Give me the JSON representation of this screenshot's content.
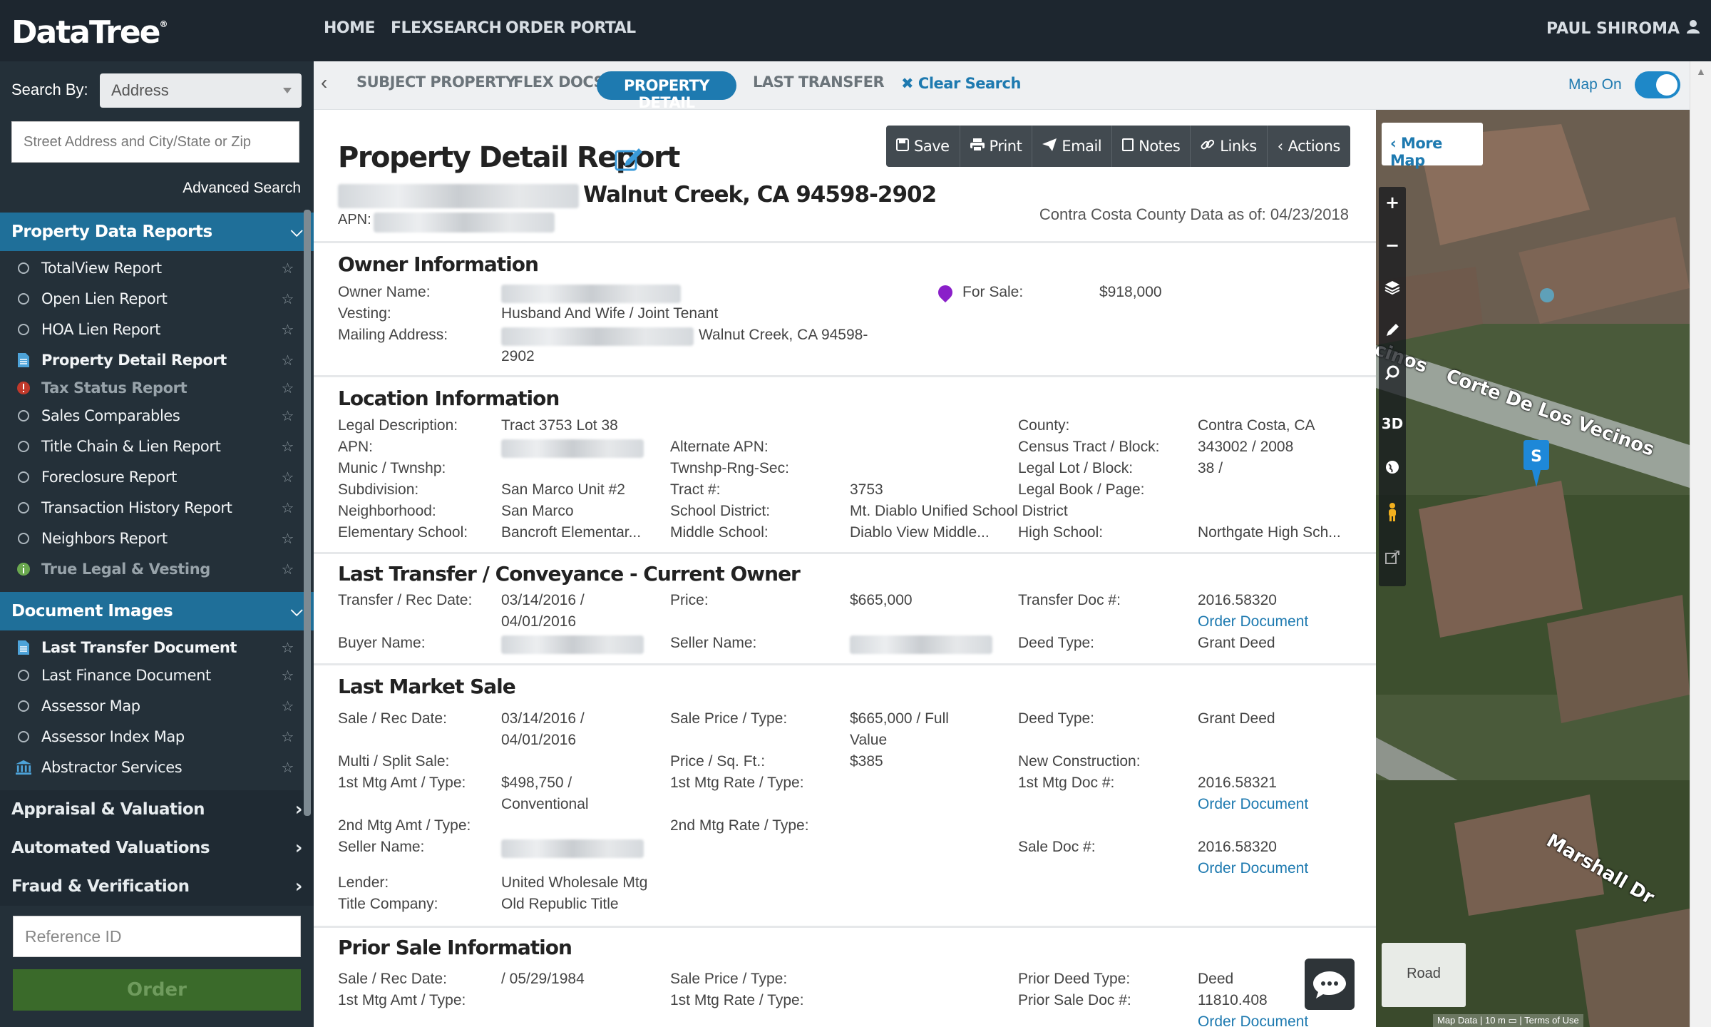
{
  "brand": {
    "logo": "DataTree"
  },
  "topnav": {
    "items": [
      "HOME",
      "FLEXSEARCH",
      "ORDER PORTAL"
    ],
    "user": "PAUL SHIROMA"
  },
  "sidebar": {
    "search_by_label": "Search By:",
    "search_by_value": "Address",
    "address_placeholder": "Street Address and City/State or Zip",
    "advanced_search": "Advanced Search",
    "property_reports_title": "Property Data Reports",
    "property_reports": [
      {
        "label": "TotalView Report",
        "icon": "circle-icon"
      },
      {
        "label": "Open Lien Report",
        "icon": "circle-icon"
      },
      {
        "label": "HOA Lien Report",
        "icon": "circle-icon"
      },
      {
        "label": "Property Detail Report",
        "icon": "document-icon",
        "active": true
      },
      {
        "label": "Tax Status Report",
        "icon": "alert-icon",
        "disabled": true
      },
      {
        "label": "Sales Comparables",
        "icon": "circle-icon"
      },
      {
        "label": "Title Chain & Lien Report",
        "icon": "circle-icon"
      },
      {
        "label": "Foreclosure Report",
        "icon": "circle-icon"
      },
      {
        "label": "Transaction History Report",
        "icon": "circle-icon"
      },
      {
        "label": "Neighbors Report",
        "icon": "circle-icon"
      },
      {
        "label": "True Legal & Vesting",
        "icon": "info-icon",
        "disabled": true
      }
    ],
    "document_images_title": "Document Images",
    "document_images": [
      {
        "label": "Last Transfer Document",
        "icon": "document-icon",
        "active": true
      },
      {
        "label": "Last Finance Document",
        "icon": "circle-icon"
      },
      {
        "label": "Assessor Map",
        "icon": "circle-icon"
      },
      {
        "label": "Assessor Index Map",
        "icon": "circle-icon"
      },
      {
        "label": "Abstractor Services",
        "icon": "bank-icon"
      }
    ],
    "collapsed_sections": [
      "Appraisal & Valuation",
      "Automated Valuations",
      "Fraud & Verification"
    ],
    "reference_placeholder": "Reference ID",
    "order_button": "Order"
  },
  "tabs": {
    "items": [
      "SUBJECT PROPERTY",
      "FLEX DOCS",
      "PROPERTY DETAIL",
      "LAST TRANSFER"
    ],
    "active": "PROPERTY DETAIL",
    "clear_search": "Clear Search",
    "map_toggle_label": "Map On"
  },
  "report": {
    "title": "Property Detail Report",
    "address_city": "Walnut Creek, CA 94598-2902",
    "apn_label": "APN:",
    "as_of": "Contra Costa County Data as of: 04/23/2018",
    "toolbar": [
      "Save",
      "Print",
      "Email",
      "Notes",
      "Links",
      "Actions"
    ],
    "owner": {
      "title": "Owner Information",
      "owner_name_label": "Owner Name:",
      "vesting_label": "Vesting:",
      "vesting": "Husband And Wife / Joint Tenant",
      "mailing_label": "Mailing Address:",
      "mailing_city": "Walnut Creek, CA 94598-",
      "mailing_zip4": "2902",
      "for_sale_label": "For Sale:",
      "for_sale_price": "$918,000"
    },
    "location": {
      "title": "Location Information",
      "legal_desc_label": "Legal Description:",
      "legal_desc": "Tract 3753 Lot 38",
      "apn_label": "APN:",
      "munic_label": "Munic / Twnshp:",
      "subdivision_label": "Subdivision:",
      "subdivision": "San Marco Unit #2",
      "neighborhood_label": "Neighborhood:",
      "neighborhood": "San Marco",
      "elem_label": "Elementary School:",
      "elem": "Bancroft Elementar...",
      "alt_apn_label": "Alternate APN:",
      "trs_label": "Twnshp-Rng-Sec:",
      "tract_label": "Tract #:",
      "tract": "3753",
      "district_label": "School District:",
      "district": "Mt. Diablo Unified School District",
      "middle_label": "Middle School:",
      "middle": "Diablo View Middle...",
      "county_label": "County:",
      "county": "Contra Costa, CA",
      "census_label": "Census Tract / Block:",
      "census": "343002 / 2008",
      "lot_label": "Legal Lot / Block:",
      "lot": "38 /",
      "book_label": "Legal Book / Page:",
      "high_label": "High School:",
      "high": "Northgate High Sch..."
    },
    "transfer": {
      "title": "Last Transfer / Conveyance - Current Owner",
      "date_label": "Transfer / Rec Date:",
      "date1": "03/14/2016 /",
      "date2": "04/01/2016",
      "buyer_label": "Buyer Name:",
      "price_label": "Price:",
      "price": "$665,000",
      "seller_label": "Seller Name:",
      "doc_label": "Transfer Doc #:",
      "doc": "2016.58320",
      "order_link": "Order Document",
      "deed_label": "Deed Type:",
      "deed": "Grant Deed"
    },
    "market": {
      "title": "Last Market Sale",
      "date_label": "Sale / Rec Date:",
      "date1": "03/14/2016 /",
      "date2": "04/01/2016",
      "multi_label": "Multi / Split Sale:",
      "mtg1_label": "1st Mtg Amt / Type:",
      "mtg1a": "$498,750 /",
      "mtg1b": "Conventional",
      "mtg2_label": "2nd Mtg Amt / Type:",
      "seller_label": "Seller Name:",
      "lender_label": "Lender:",
      "lender": "United Wholesale Mtg",
      "title_co_label": "Title Company:",
      "title_co": "Old Republic Title",
      "price_label": "Sale Price / Type:",
      "price1": "$665,000 / Full",
      "price2": "Value",
      "sqft_label": "Price / Sq. Ft.:",
      "sqft": "$385",
      "rate1_label": "1st Mtg Rate / Type:",
      "rate2_label": "2nd Mtg Rate / Type:",
      "deed_label": "Deed Type:",
      "deed": "Grant Deed",
      "newcon_label": "New Construction:",
      "mtgdoc_label": "1st Mtg Doc #:",
      "mtgdoc": "2016.58321",
      "saledoc_label": "Sale Doc #:",
      "saledoc": "2016.58320",
      "order_link": "Order Document"
    },
    "prior": {
      "title": "Prior Sale Information",
      "date_label": "Sale / Rec Date:",
      "date": "/ 05/29/1984",
      "mtg1_label": "1st Mtg Amt / Type:",
      "price_label": "Sale Price / Type:",
      "rate1_label": "1st Mtg Rate / Type:",
      "deed_label": "Prior Deed Type:",
      "deed": "Deed",
      "doc_label": "Prior Sale Doc #:",
      "doc": "11810.408",
      "order_link": "Order Document"
    }
  },
  "map": {
    "more_map": "More Map",
    "tools": [
      "+",
      "−",
      "layers-icon",
      "pencil-icon",
      "search-icon",
      "3D",
      "globe-icon",
      "pegman-icon",
      "external-icon"
    ],
    "marker": "S",
    "streets": [
      "Corte De Los Vecinos",
      "Marshall Dr"
    ],
    "road_button": "Road",
    "footer": [
      "Map Data",
      "10 m",
      "Terms of Use"
    ]
  }
}
